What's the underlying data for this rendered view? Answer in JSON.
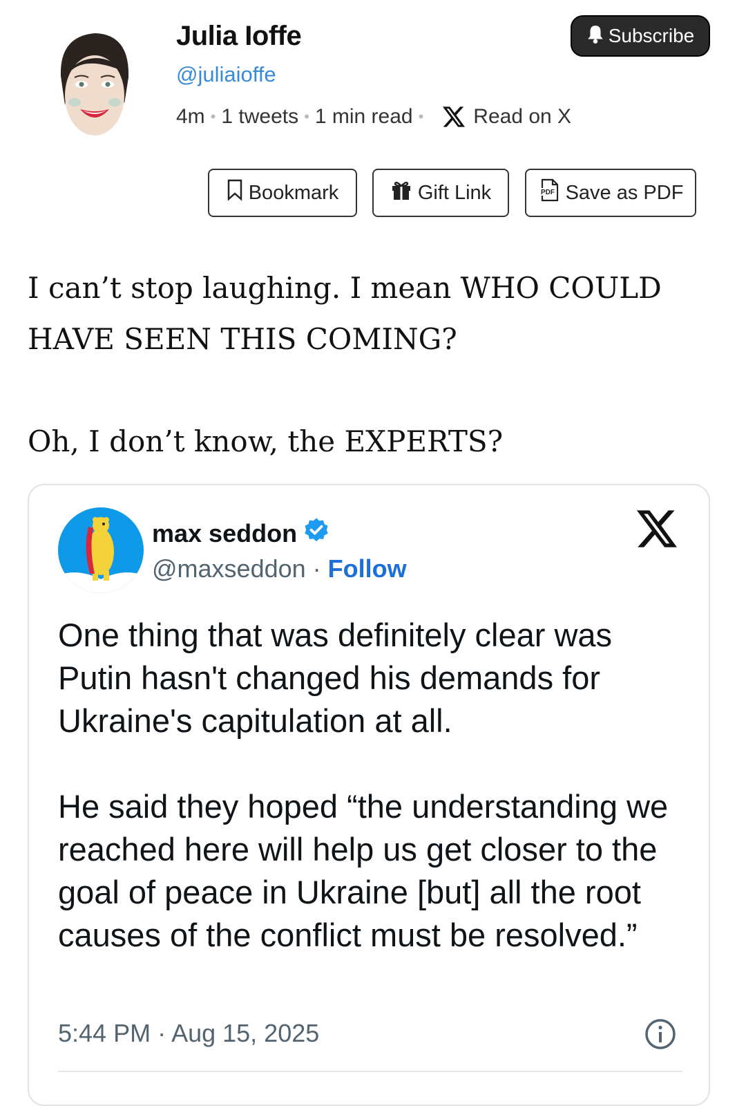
{
  "author": {
    "name": "Julia Ioffe",
    "handle": "@juliaioffe",
    "avatar_icon": "caricature-avatar"
  },
  "meta": {
    "age": "4m",
    "tweets": "1 tweets",
    "read_time": "1 min read",
    "read_on": "Read on X"
  },
  "subscribe": {
    "label": "Subscribe",
    "icon": "bell-icon"
  },
  "actions": {
    "bookmark": "Bookmark",
    "gift": "Gift Link",
    "pdf": "Save as PDF",
    "pdf_icon_text": "PDF"
  },
  "post": {
    "line1": "I can’t stop laughing. I mean WHO COULD HAVE SEEN THIS COMING?",
    "line2": "Oh, I don’t know, the EXPERTS?"
  },
  "embedded_tweet": {
    "name": "max seddon",
    "handle": "@maxseddon",
    "separator": "·",
    "follow": "Follow",
    "verified": true,
    "paragraph1": "One thing that was definitely clear was Putin hasn't changed his demands for Ukraine's capitulation at all.",
    "paragraph2": "He said they hoped “the understanding we reached here will help us get closer to the goal of peace in Ukraine [but] all the root causes of the conflict must be resolved.”",
    "timestamp": "5:44 PM · Aug 15, 2025"
  },
  "colors": {
    "handle_blue": "#3a8bd6",
    "follow_blue": "#1d6fd8",
    "verified_blue": "#1d9bf0",
    "subscribe_bg": "#2a2a2a"
  }
}
